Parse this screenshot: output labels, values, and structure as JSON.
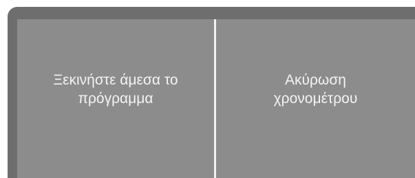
{
  "buttons": {
    "start_now": {
      "label": "Ξεκινήστε άμεσα το\nπρόγραμμα"
    },
    "cancel_timer": {
      "label": "Ακύρωση\nχρονομέτρου"
    }
  }
}
